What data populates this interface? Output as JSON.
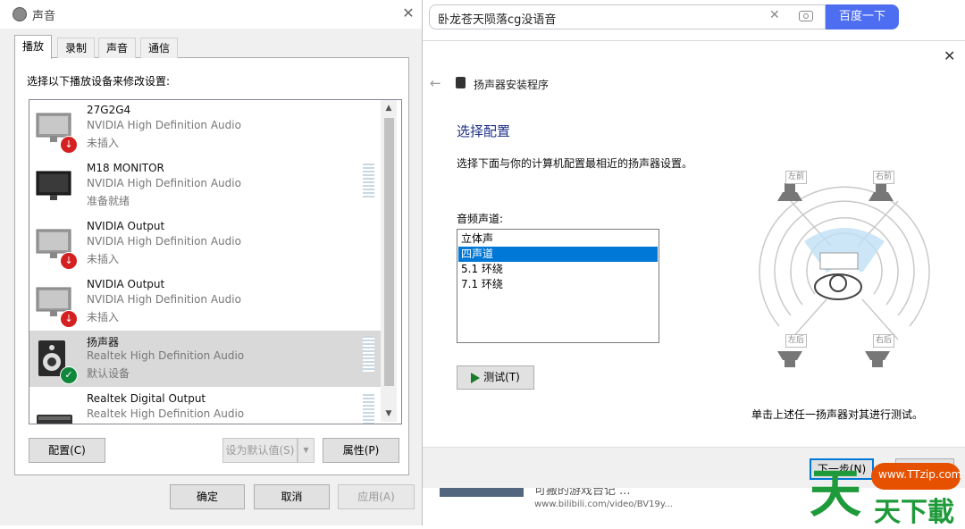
{
  "sound_dialog": {
    "title": "声音",
    "tabs": [
      "播放",
      "录制",
      "声音",
      "通信"
    ],
    "instruction": "选择以下播放设备来修改设置:",
    "devices": [
      {
        "name": "27G2G4",
        "driver": "NVIDIA High Definition Audio",
        "status": "未插入"
      },
      {
        "name": "M18  MONITOR",
        "driver": "NVIDIA High Definition Audio",
        "status": "准备就绪"
      },
      {
        "name": "NVIDIA Output",
        "driver": "NVIDIA High Definition Audio",
        "status": "未插入"
      },
      {
        "name": "NVIDIA Output",
        "driver": "NVIDIA High Definition Audio",
        "status": "未插入"
      },
      {
        "name": "扬声器",
        "driver": "Realtek High Definition Audio",
        "status": "默认设备"
      },
      {
        "name": "Realtek Digital Output",
        "driver": "Realtek High Definition Audio",
        "status": ""
      }
    ],
    "buttons": {
      "configure": "配置(C)",
      "set_default": "设为默认值(S)",
      "properties": "属性(P)",
      "ok": "确定",
      "cancel": "取消",
      "apply": "应用(A)"
    }
  },
  "browser": {
    "search_value": "卧龙苍天陨落cg没语音",
    "search_button": "百度一下",
    "snippet": "可搬的游戏台记 ...",
    "url": "www.bilibili.com/video/BV19y..."
  },
  "wizard": {
    "title": "扬声器安装程序",
    "heading": "选择配置",
    "instruction": "选择下面与你的计算机配置最相近的扬声器设置。",
    "channel_label": "音频声道:",
    "channels": [
      "立体声",
      "四声道",
      "5.1 环绕",
      "7.1 环绕"
    ],
    "selected_channel": "四声道",
    "test_button": "测试(T)",
    "hint": "单击上述任一扬声器对其进行测试。",
    "speaker_labels": {
      "front_left": "左前",
      "front_right": "右前",
      "rear_left": "左后",
      "rear_right": "右后"
    },
    "next_button": "下一步(N)",
    "cancel_button": "取消"
  },
  "watermark": {
    "site": "www.TTzip.com",
    "logo_char": "天",
    "text": "天下載"
  },
  "colors": {
    "accent_blue": "#0078d7",
    "heading_blue": "#1e3287",
    "search_blue": "#4e6ef2",
    "watermark_green": "#1e9a3a",
    "status_red": "#d42020",
    "status_green": "#11873b"
  }
}
